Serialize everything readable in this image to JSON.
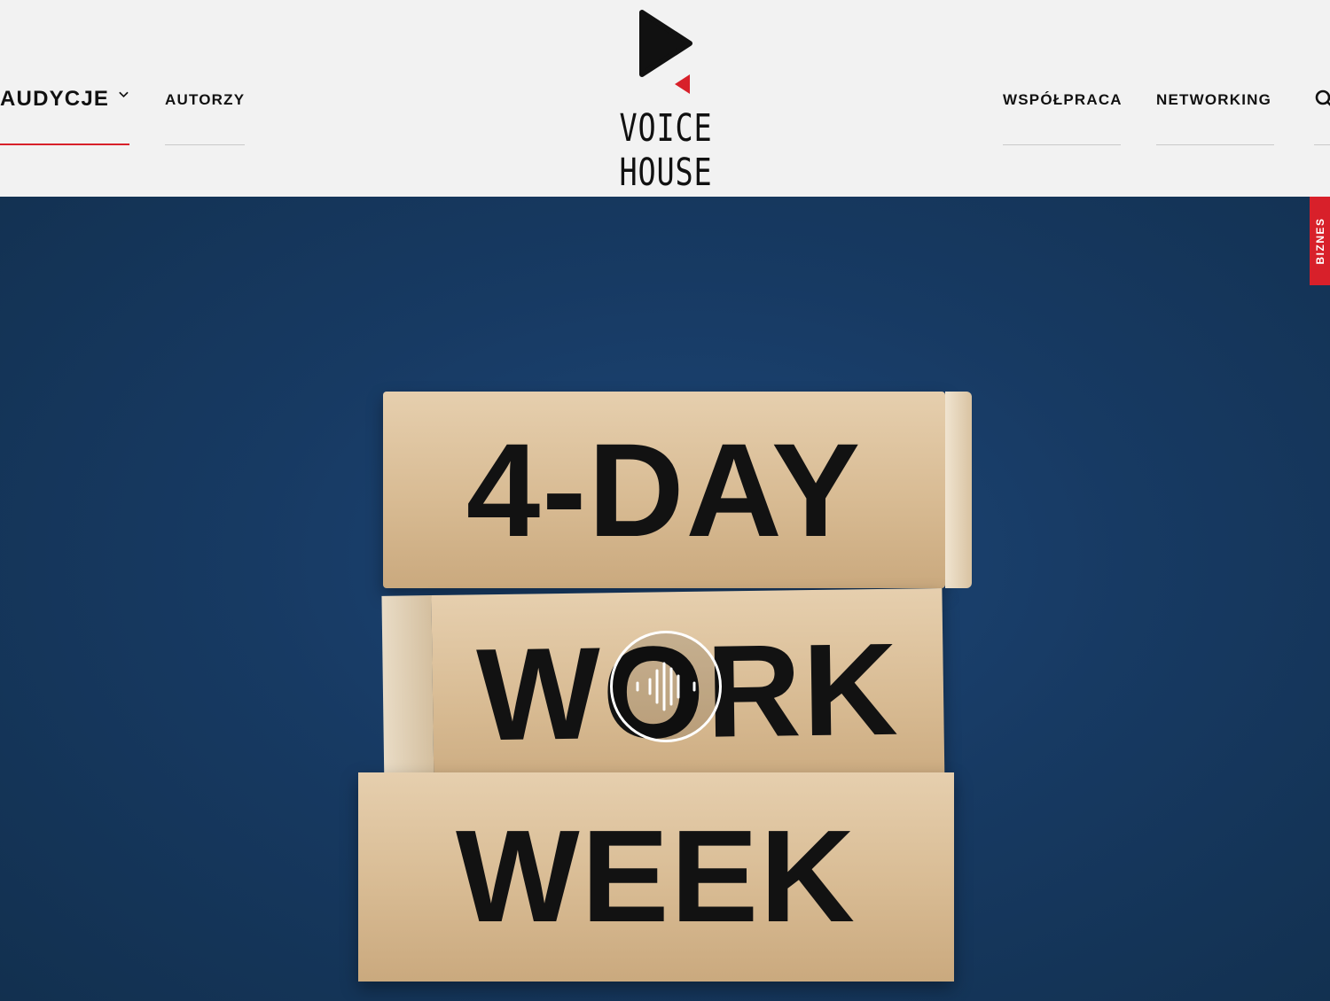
{
  "brand": {
    "name": "VOICE HOUSE"
  },
  "nav": {
    "left": [
      {
        "label": "AUDYCJE",
        "active": true,
        "has_dropdown": true
      },
      {
        "label": "AUTORZY"
      }
    ],
    "right": [
      {
        "label": "WSPÓŁPRACA"
      },
      {
        "label": "NETWORKING"
      }
    ],
    "search_icon": "search-icon"
  },
  "colors": {
    "accent": "#d8202a",
    "background": "#f2f2f2",
    "hero": "#173a63"
  },
  "hero": {
    "category": "BIZNES",
    "image_text": {
      "line1": "4-DAY",
      "line2": "WORK",
      "line3": "WEEK"
    },
    "play_icon": "audio-wave-icon"
  }
}
